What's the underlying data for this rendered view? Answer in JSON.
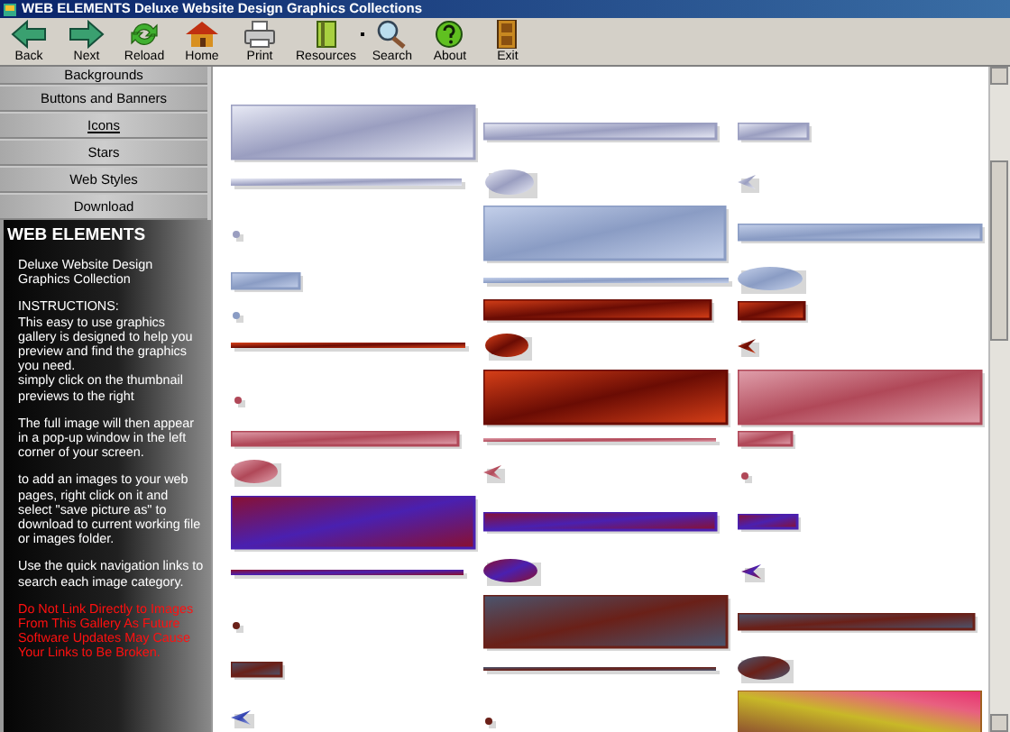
{
  "window": {
    "title": "WEB ELEMENTS Deluxe Website Design Graphics Collections"
  },
  "toolbar": [
    {
      "label": "Back",
      "kind": "back"
    },
    {
      "label": "Next",
      "kind": "next"
    },
    {
      "label": "Reload",
      "kind": "reload"
    },
    {
      "label": "Home",
      "kind": "home"
    },
    {
      "label": "Print",
      "kind": "print"
    },
    {
      "label": "Resources",
      "kind": "resources"
    },
    {
      "label": "Search",
      "kind": "search"
    },
    {
      "label": "About",
      "kind": "about"
    },
    {
      "label": "Exit",
      "kind": "exit"
    }
  ],
  "nav": [
    {
      "label": "Backgrounds",
      "selected": false
    },
    {
      "label": "Buttons and Banners",
      "selected": false
    },
    {
      "label": "Icons",
      "selected": true
    },
    {
      "label": "Stars",
      "selected": false
    },
    {
      "label": "Web Styles",
      "selected": false
    },
    {
      "label": "Download",
      "selected": false
    }
  ],
  "sidebar": {
    "heading": "WEB ELEMENTS",
    "paragraphs": [
      {
        "kind": "normal",
        "text": "Deluxe Website Design Graphics Collection"
      },
      {
        "kind": "normal",
        "text": "INSTRUCTIONS:\nThis easy to use graphics gallery is designed to help you preview and find the graphics you need.\nsimply click on the thumbnail previews to the right"
      },
      {
        "kind": "normal",
        "text": "The full image will then appear in a pop-up window in the left corner of your screen."
      },
      {
        "kind": "normal",
        "text": "to add an images to your web pages, right click on it and select \"save picture as\" to download to current working file or images folder."
      },
      {
        "kind": "normal",
        "text": "Use the quick navigation links to search each image category."
      },
      {
        "kind": "warning",
        "text": "Do Not Link Directly to Images From This Gallery As Future Software Updates May Cause Your Links to Be Broken."
      }
    ]
  }
}
